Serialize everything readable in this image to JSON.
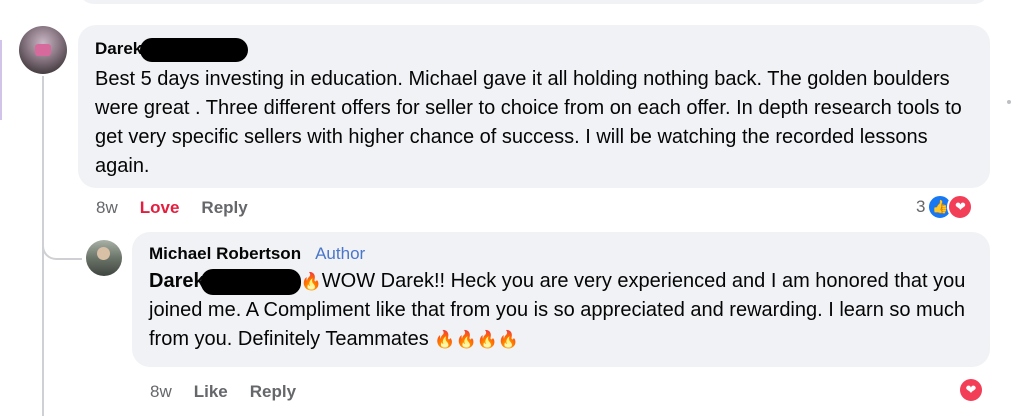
{
  "comment": {
    "author": "Darek",
    "text": "Best 5 days investing in education. Michael gave it all holding nothing back. The golden boulders were great . Three different offers for seller to choice from on each offer. In depth research tools to get very specific sellers with higher chance of success. I will be watching the recorded lessons again.",
    "time": "8w",
    "reaction_label": "Love",
    "reply_label": "Reply",
    "reaction_count": "3"
  },
  "reply": {
    "author": "Michael Robertson",
    "badge": "Author",
    "mention": "Darek",
    "text_1": "WOW Darek!! Heck you are very experienced and I am honored that you joined me. A Compliment like that from you is so appreciated and rewarding. I learn so much from you. Definitely Teammates",
    "fire": "🔥",
    "fires": "🔥🔥🔥🔥",
    "time": "8w",
    "like_label": "Like",
    "reply_label": "Reply"
  },
  "icons": {
    "like": "👍",
    "heart": "❤"
  }
}
